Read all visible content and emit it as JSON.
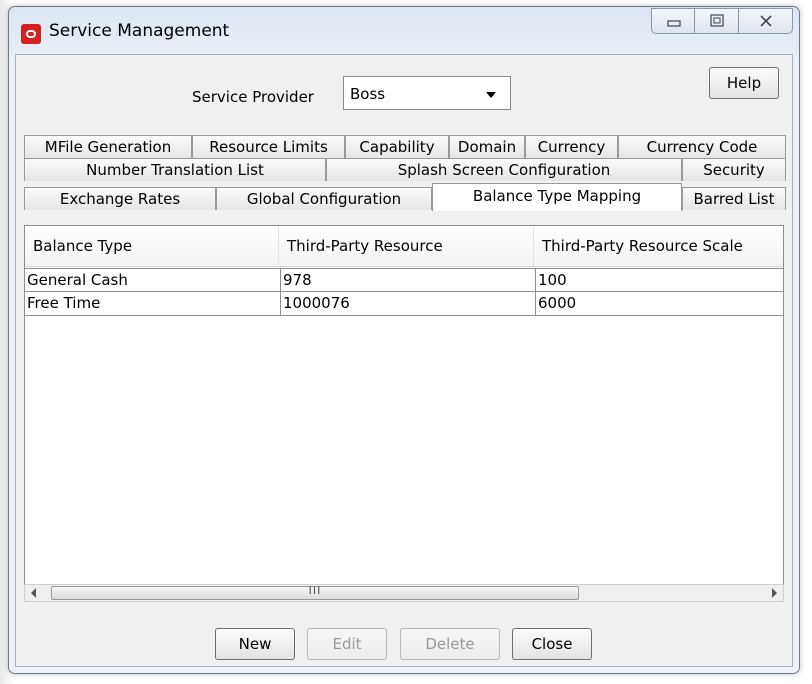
{
  "window": {
    "title": "Service Management",
    "caption_buttons": [
      "minimize",
      "maximize",
      "close"
    ]
  },
  "service_provider": {
    "label": "Service Provider",
    "selected": "Boss"
  },
  "help_label": "Help",
  "tabs": {
    "row1": [
      "MFile Generation",
      "Resource Limits",
      "Capability",
      "Domain",
      "Currency",
      "Currency Code"
    ],
    "row2": [
      "Number Translation List",
      "Splash Screen Configuration",
      "Security"
    ],
    "row3": [
      "Exchange Rates",
      "Global Configuration",
      "Balance Type Mapping",
      "Barred List"
    ],
    "active": "Balance Type Mapping"
  },
  "table": {
    "columns": [
      "Balance Type",
      "Third-Party Resource",
      "Third-Party Resource Scale"
    ],
    "rows": [
      [
        "General Cash",
        "978",
        "100"
      ],
      [
        "Free Time",
        "1000076",
        "6000"
      ]
    ]
  },
  "scrollbar": {
    "grip": "III"
  },
  "buttons": {
    "new": "New",
    "edit": "Edit",
    "delete": "Delete",
    "close": "Close"
  },
  "colors": {
    "frame": "#dce6f3",
    "client": "#f0f0f0",
    "app_icon": "#d32020"
  }
}
